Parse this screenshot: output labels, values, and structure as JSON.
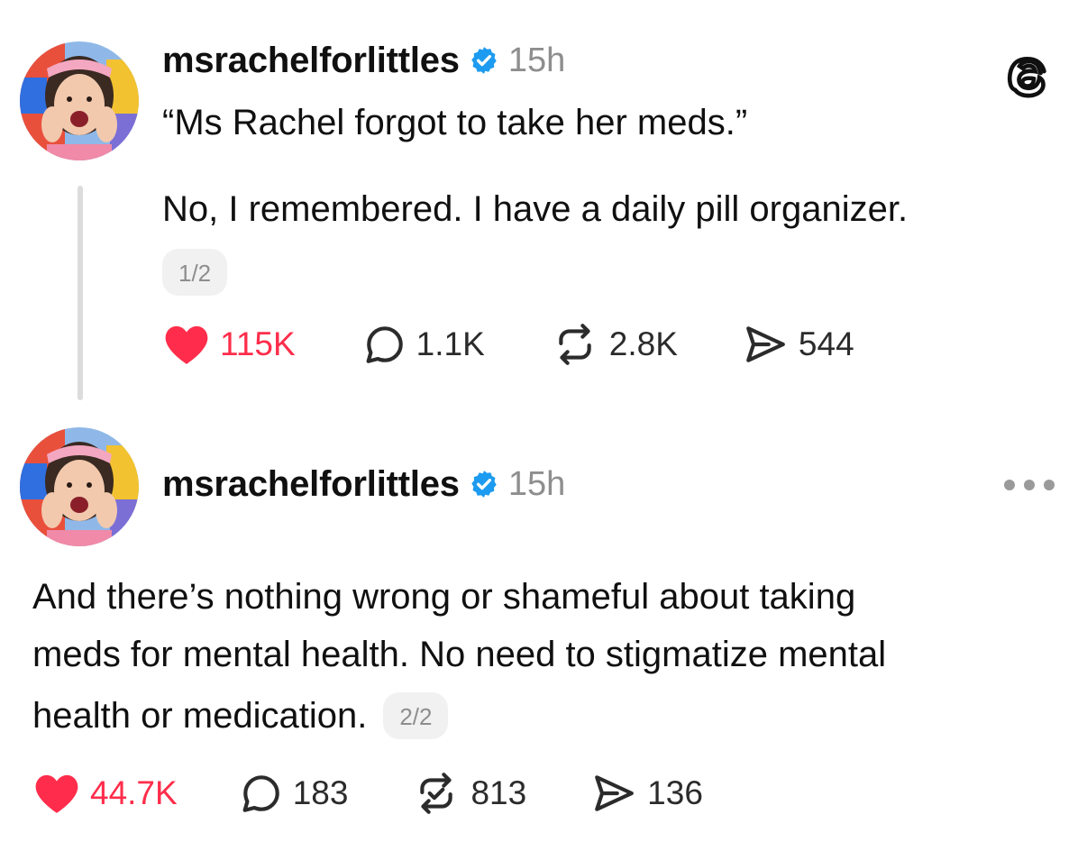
{
  "threads_logo": {
    "icon": "threads-icon"
  },
  "posts": [
    {
      "username": "msrachelforlittles",
      "time": "15h",
      "verified_color": "#1d9bf0",
      "line1": "“Ms Rachel forgot to take her meds.”",
      "line2": "No, I remembered. I have a daily pill organizer.",
      "pager": "1/2",
      "likes": "115K",
      "replies": "1.1K",
      "reposts": "2.8K",
      "shares": "544"
    },
    {
      "username": "msrachelforlittles",
      "time": "15h",
      "more_icon": "more-icon",
      "lines": [
        "And there’s nothing wrong or shameful about taking",
        "meds for mental health. No need to stigmatize mental",
        "health or medication."
      ],
      "pager": "2/2",
      "likes": "44.7K",
      "replies": "183",
      "reposts": "813",
      "shares": "136"
    }
  ],
  "colors": {
    "like": "#ff2d4b",
    "muted": "#8e8e8e",
    "thread_line": "#dcdcdc"
  }
}
